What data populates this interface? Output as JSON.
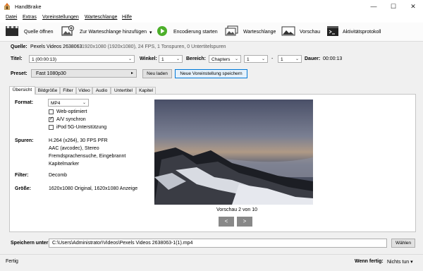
{
  "window": {
    "title": "HandBrake"
  },
  "menu": [
    "Datei",
    "Extras",
    "Voreinstellungen",
    "Warteschlange",
    "Hilfe"
  ],
  "toolbar": {
    "open_source": "Quelle öffnen",
    "add_queue": "Zur Warteschlange hinzufügen",
    "add_queue_arrow": "▾",
    "start": "Encodierung starten",
    "queue": "Warteschlange",
    "preview": "Vorschau",
    "activity": "Aktivitätsprotokoll"
  },
  "source": {
    "label": "Quelle:",
    "name": "Pexels Videos 2638063",
    "info": "1920x1080 (1920x1080), 24 FPS, 1 Tonspuren, 0 Untertitelspuren"
  },
  "title_row": {
    "title_label": "Titel:",
    "title_value": "1 (00:00:13)",
    "angle_label": "Winkel:",
    "angle_value": "1",
    "range_label": "Bereich:",
    "range_type": "Chapters",
    "range_from": "1",
    "range_sep": "-",
    "range_to": "1",
    "duration_label": "Dauer:",
    "duration_value": "00:00:13"
  },
  "preset": {
    "label": "Preset:",
    "value": "Fast 1080p30",
    "arrow": "▸",
    "reload": "Neu laden",
    "save_new": "Neue Voreinstellung speichern"
  },
  "tabs": [
    "Übersicht",
    "Bildgröße",
    "Filter",
    "Video",
    "Audio",
    "Untertitel",
    "Kapitel"
  ],
  "summary": {
    "format_label": "Format:",
    "format_value": "MP4",
    "checkboxes": [
      {
        "label": "Web-optimiert",
        "checked": false
      },
      {
        "label": "A/V synchron",
        "checked": true
      },
      {
        "label": "iPod 5G-Unterstützung",
        "checked": false
      }
    ],
    "tracks_label": "Spuren:",
    "tracks": [
      "H.264 (x264), 30 FPS PFR",
      "AAC (avcodec), Stereo",
      "Fremdsprachensuche, Eingebrannt",
      "Kapitelmarker"
    ],
    "filter_label": "Filter:",
    "filter_value": "Decomb",
    "size_label": "Größe:",
    "size_value": "1620x1080 Original, 1620x1080 Anzeige",
    "preview_caption": "Vorschau 2 von 10",
    "prev": "<",
    "next": ">"
  },
  "save": {
    "label": "Speichern unter:",
    "path": "C:\\Users\\Administrator\\Videos\\Pexels Videos 2638063-1(1).mp4",
    "browse": "Wählen"
  },
  "status": {
    "text": "Fertig",
    "when_done_label": "Wenn fertig:",
    "when_done_value": "Nichts tun",
    "when_done_arrow": "▾"
  },
  "colors": {
    "accent": "#0078d7",
    "start_green": "#4caf2a"
  }
}
